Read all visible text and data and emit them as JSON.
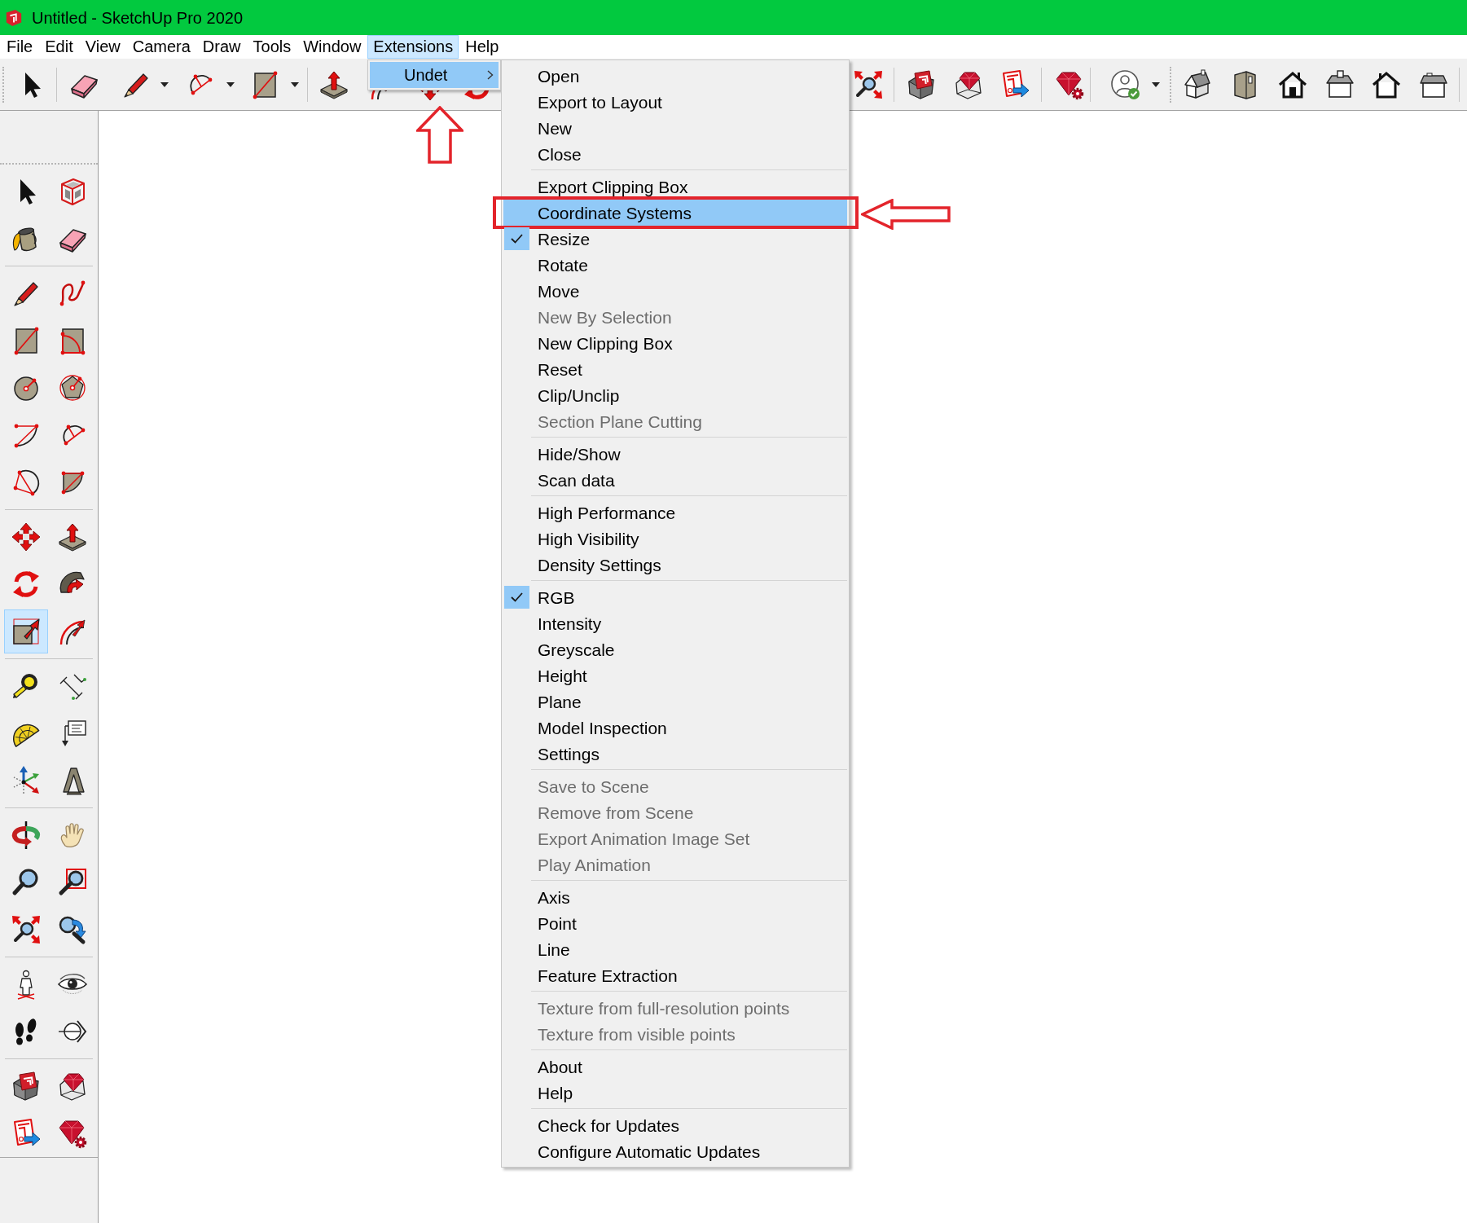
{
  "window": {
    "title": "Untitled - SketchUp Pro 2020"
  },
  "menu_bar": [
    {
      "label": "File",
      "selected": false
    },
    {
      "label": "Edit",
      "selected": false
    },
    {
      "label": "View",
      "selected": false
    },
    {
      "label": "Camera",
      "selected": false
    },
    {
      "label": "Draw",
      "selected": false
    },
    {
      "label": "Tools",
      "selected": false
    },
    {
      "label": "Window",
      "selected": false
    },
    {
      "label": "Extensions",
      "selected": true
    },
    {
      "label": "Help",
      "selected": false
    }
  ],
  "extensions_menu": {
    "items": [
      {
        "label": "Undet",
        "selected": true
      }
    ]
  },
  "undet_menu": {
    "groups": [
      {
        "items": [
          {
            "label": "Open",
            "checked": false,
            "disabled": false,
            "selected": false
          },
          {
            "label": "Export to Layout",
            "checked": false,
            "disabled": false,
            "selected": false
          },
          {
            "label": "New",
            "checked": false,
            "disabled": false,
            "selected": false
          },
          {
            "label": "Close",
            "checked": false,
            "disabled": false,
            "selected": false
          }
        ]
      },
      {
        "items": [
          {
            "label": "Export Clipping Box",
            "checked": false,
            "disabled": false,
            "selected": false
          },
          {
            "label": "Coordinate Systems",
            "checked": false,
            "disabled": false,
            "selected": true
          },
          {
            "label": "Resize",
            "checked": true,
            "disabled": false,
            "selected": false
          },
          {
            "label": "Rotate",
            "checked": false,
            "disabled": false,
            "selected": false
          },
          {
            "label": "Move",
            "checked": false,
            "disabled": false,
            "selected": false
          },
          {
            "label": "New By Selection",
            "checked": false,
            "disabled": true,
            "selected": false
          },
          {
            "label": "New Clipping Box",
            "checked": false,
            "disabled": false,
            "selected": false
          },
          {
            "label": "Reset",
            "checked": false,
            "disabled": false,
            "selected": false
          },
          {
            "label": "Clip/Unclip",
            "checked": false,
            "disabled": false,
            "selected": false
          },
          {
            "label": "Section Plane Cutting",
            "checked": false,
            "disabled": true,
            "selected": false
          }
        ]
      },
      {
        "items": [
          {
            "label": "Hide/Show",
            "checked": false,
            "disabled": false,
            "selected": false
          },
          {
            "label": "Scan data",
            "checked": false,
            "disabled": false,
            "selected": false
          }
        ]
      },
      {
        "items": [
          {
            "label": "High Performance",
            "checked": false,
            "disabled": false,
            "selected": false
          },
          {
            "label": "High Visibility",
            "checked": false,
            "disabled": false,
            "selected": false
          },
          {
            "label": "Density Settings",
            "checked": false,
            "disabled": false,
            "selected": false
          }
        ]
      },
      {
        "items": [
          {
            "label": "RGB",
            "checked": true,
            "disabled": false,
            "selected": false
          },
          {
            "label": "Intensity",
            "checked": false,
            "disabled": false,
            "selected": false
          },
          {
            "label": "Greyscale",
            "checked": false,
            "disabled": false,
            "selected": false
          },
          {
            "label": "Height",
            "checked": false,
            "disabled": false,
            "selected": false
          },
          {
            "label": "Plane",
            "checked": false,
            "disabled": false,
            "selected": false
          },
          {
            "label": "Model Inspection",
            "checked": false,
            "disabled": false,
            "selected": false
          },
          {
            "label": "Settings",
            "checked": false,
            "disabled": false,
            "selected": false
          }
        ]
      },
      {
        "items": [
          {
            "label": "Save to Scene",
            "checked": false,
            "disabled": true,
            "selected": false
          },
          {
            "label": "Remove from Scene",
            "checked": false,
            "disabled": true,
            "selected": false
          },
          {
            "label": "Export Animation Image Set",
            "checked": false,
            "disabled": true,
            "selected": false
          },
          {
            "label": "Play Animation",
            "checked": false,
            "disabled": true,
            "selected": false
          }
        ]
      },
      {
        "items": [
          {
            "label": "Axis",
            "checked": false,
            "disabled": false,
            "selected": false
          },
          {
            "label": "Point",
            "checked": false,
            "disabled": false,
            "selected": false
          },
          {
            "label": "Line",
            "checked": false,
            "disabled": false,
            "selected": false
          },
          {
            "label": "Feature Extraction",
            "checked": false,
            "disabled": false,
            "selected": false
          }
        ]
      },
      {
        "items": [
          {
            "label": "Texture from full-resolution points",
            "checked": false,
            "disabled": true,
            "selected": false
          },
          {
            "label": "Texture from visible points",
            "checked": false,
            "disabled": true,
            "selected": false
          }
        ]
      },
      {
        "items": [
          {
            "label": "About",
            "checked": false,
            "disabled": false,
            "selected": false
          },
          {
            "label": "Help",
            "checked": false,
            "disabled": false,
            "selected": false
          }
        ]
      },
      {
        "items": [
          {
            "label": "Check for Updates",
            "checked": false,
            "disabled": false,
            "selected": false
          },
          {
            "label": "Configure Automatic Updates",
            "checked": false,
            "disabled": false,
            "selected": false
          }
        ]
      }
    ]
  },
  "tool_palette": {
    "groups": [
      {
        "tools": [
          {
            "selected": false
          },
          {
            "selected": false
          },
          {
            "selected": false
          },
          {
            "selected": false
          }
        ]
      },
      {
        "tools": [
          {
            "selected": false
          },
          {
            "selected": false
          },
          {
            "selected": false
          },
          {
            "selected": false
          },
          {
            "selected": false
          },
          {
            "selected": false
          },
          {
            "selected": false
          },
          {
            "selected": false
          },
          {
            "selected": false
          },
          {
            "selected": false
          }
        ]
      },
      {
        "tools": [
          {
            "selected": false
          },
          {
            "selected": false
          },
          {
            "selected": false
          },
          {
            "selected": false
          },
          {
            "selected": true
          },
          {
            "selected": false
          }
        ]
      },
      {
        "tools": [
          {
            "selected": false
          },
          {
            "selected": false
          },
          {
            "selected": false
          },
          {
            "selected": false
          },
          {
            "selected": false
          },
          {
            "selected": false
          }
        ]
      },
      {
        "tools": [
          {
            "selected": false
          },
          {
            "selected": false
          },
          {
            "selected": false
          },
          {
            "selected": false
          },
          {
            "selected": false
          },
          {
            "selected": false
          }
        ]
      },
      {
        "tools": [
          {
            "selected": false
          },
          {
            "selected": false
          },
          {
            "selected": false
          },
          {
            "selected": false
          }
        ]
      },
      {
        "tools": [
          {
            "selected": false
          },
          {
            "selected": false
          },
          {
            "selected": false
          },
          {
            "selected": false
          }
        ]
      }
    ]
  }
}
